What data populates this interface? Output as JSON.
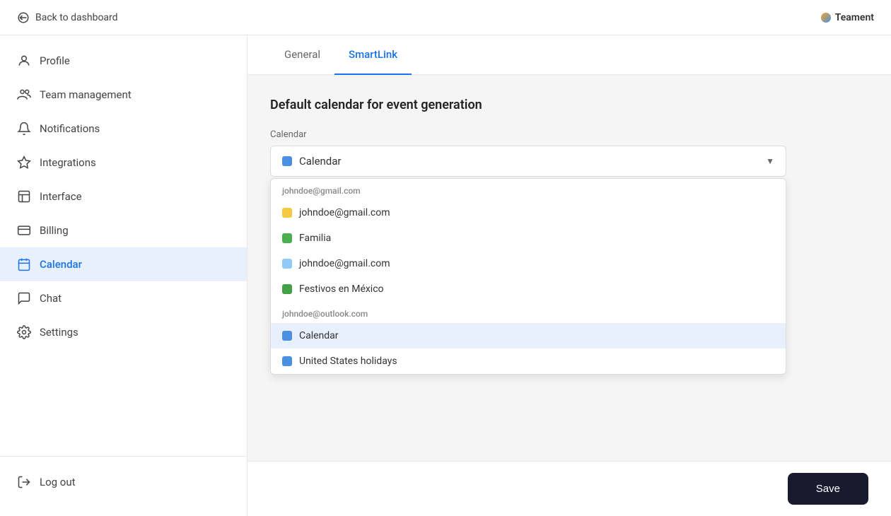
{
  "topbar": {
    "back_label": "Back to dashboard",
    "brand_name": "Teament"
  },
  "sidebar": {
    "items": [
      {
        "id": "profile",
        "label": "Profile",
        "icon": "user-icon",
        "active": false
      },
      {
        "id": "team-management",
        "label": "Team management",
        "icon": "team-icon",
        "active": false
      },
      {
        "id": "notifications",
        "label": "Notifications",
        "icon": "bell-icon",
        "active": false
      },
      {
        "id": "integrations",
        "label": "Integrations",
        "icon": "integrations-icon",
        "active": false
      },
      {
        "id": "interface",
        "label": "Interface",
        "icon": "interface-icon",
        "active": false
      },
      {
        "id": "billing",
        "label": "Billing",
        "icon": "billing-icon",
        "active": false
      },
      {
        "id": "calendar",
        "label": "Calendar",
        "icon": "calendar-icon",
        "active": true
      },
      {
        "id": "chat",
        "label": "Chat",
        "icon": "chat-icon",
        "active": false
      },
      {
        "id": "settings",
        "label": "Settings",
        "icon": "settings-icon",
        "active": false
      }
    ],
    "bottom_items": [
      {
        "id": "log-out",
        "label": "Log out",
        "icon": "logout-icon"
      }
    ]
  },
  "tabs": [
    {
      "id": "general",
      "label": "General",
      "active": false
    },
    {
      "id": "smartlink",
      "label": "SmartLink",
      "active": true
    }
  ],
  "content": {
    "section_title": "Default calendar for event generation",
    "field_label": "Calendar",
    "selected_value": "Calendar",
    "selected_color": "#4a90e2"
  },
  "dropdown": {
    "groups": [
      {
        "id": "gmail-group",
        "label": "johndoe@gmail.com",
        "options": [
          {
            "id": "gmail-main",
            "label": "johndoe@gmail.com",
            "color": "#f5c842",
            "selected": false
          },
          {
            "id": "familia",
            "label": "Familia",
            "color": "#4caf50",
            "selected": false
          },
          {
            "id": "gmail-secondary",
            "label": "johndoe@gmail.com",
            "color": "#90caf9",
            "selected": false
          },
          {
            "id": "festivos",
            "label": "Festivos en México",
            "color": "#43a047",
            "selected": false
          }
        ]
      },
      {
        "id": "outlook-group",
        "label": "johndoe@outlook.com",
        "options": [
          {
            "id": "calendar-outlook",
            "label": "Calendar",
            "color": "#4a90e2",
            "selected": true
          },
          {
            "id": "us-holidays",
            "label": "United States holidays",
            "color": "#4a90e2",
            "selected": false
          }
        ]
      }
    ]
  },
  "footer": {
    "save_label": "Save"
  }
}
